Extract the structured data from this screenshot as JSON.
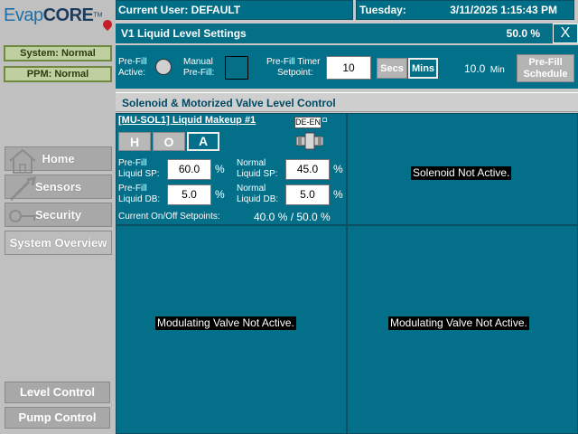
{
  "logo": {
    "text_light": "Evap",
    "text_bold": "CORE",
    "tm": "TM"
  },
  "status": {
    "system": "System: Normal",
    "ppm": "PPM: Normal"
  },
  "nav": {
    "home": "Home",
    "sensors": "Sensors",
    "security": "Security",
    "overview": "System Overview",
    "level": "Level Control",
    "pump": "Pump Control"
  },
  "topbar": {
    "user": "Current User: DEFAULT",
    "day": "Tuesday:",
    "datetime": "3/11/2025 1:15:43 PM"
  },
  "window": {
    "title": "V1 Liquid Level Settings",
    "level": "50.0 %",
    "close": "X"
  },
  "prefill": {
    "active_label_1": "Pre-Fill",
    "active_label_2": "Active:",
    "manual_label_1": "Manual",
    "manual_label_2": "Pre-Fill:",
    "timer_label_1": "Pre-Fill Timer",
    "timer_label_2": "Setpoint:",
    "timer_value": "10",
    "secs": "Secs",
    "mins": "Mins",
    "remaining_value": "10.0",
    "remaining_unit": "Min",
    "schedule_1": "Pre-Fill",
    "schedule_2": "Schedule"
  },
  "section": {
    "title": "Solenoid & Motorized Valve Level Control"
  },
  "solenoid1": {
    "link": "[MU-SOL1] Liquid Makeup #1",
    "valve_badge": "DE-EN",
    "hoa": {
      "h": "H",
      "o": "O",
      "a": "A",
      "selected": "A"
    },
    "prefill_sp_label_1": "Pre-Fill",
    "prefill_sp_label_2": "Liquid SP:",
    "prefill_sp_value": "60.0",
    "prefill_db_label_1": "Pre-Fill",
    "prefill_db_label_2": "Liquid DB:",
    "prefill_db_value": "5.0",
    "normal_sp_label_1": "Normal",
    "normal_sp_label_2": "Liquid SP:",
    "normal_sp_value": "45.0",
    "normal_db_label_1": "Normal",
    "normal_db_label_2": "Liquid DB:",
    "normal_db_value": "5.0",
    "pct": "%",
    "onoff_label": "Current On/Off Setpoints:",
    "onoff_value": "40.0 % / 50.0 %"
  },
  "messages": {
    "solenoid_inactive": "Solenoid Not Active.",
    "mod_valve_left": "Modulating Valve Not Active.",
    "mod_valve_right": "Modulating Valve Not Active."
  },
  "colors": {
    "teal": "#036f89",
    "status_green": "#bfcfa0",
    "nav_gray": "#a8a8a8"
  }
}
